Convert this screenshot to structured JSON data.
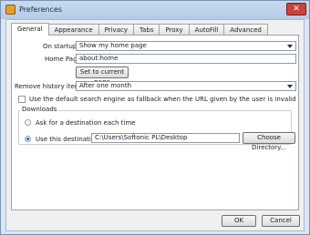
{
  "window": {
    "title": "Preferences"
  },
  "tabs": [
    {
      "label": "General"
    },
    {
      "label": "Appearance"
    },
    {
      "label": "Privacy"
    },
    {
      "label": "Tabs"
    },
    {
      "label": "Proxy"
    },
    {
      "label": "AutoFill"
    },
    {
      "label": "Advanced"
    }
  ],
  "general": {
    "on_startup_label": "On startup:",
    "on_startup_value": "Show my home page",
    "home_page_label": "Home Page:",
    "home_page_value": "about:home",
    "set_current_label": "Set to current page",
    "remove_history_label": "Remove history items:",
    "remove_history_value": "After one month",
    "fallback_label": "Use the default search engine as fallback when the URL given by the user is invalid",
    "fallback_checked": false
  },
  "downloads": {
    "group_label": "Downloads",
    "ask_label": "Ask for a destination each time",
    "use_label": "Use this destination:",
    "destination_value": "C:\\Users\\Softonic PL\\Desktop",
    "choose_label": "Choose Directory..."
  },
  "footer": {
    "ok_label": "OK",
    "cancel_label": "Cancel"
  }
}
